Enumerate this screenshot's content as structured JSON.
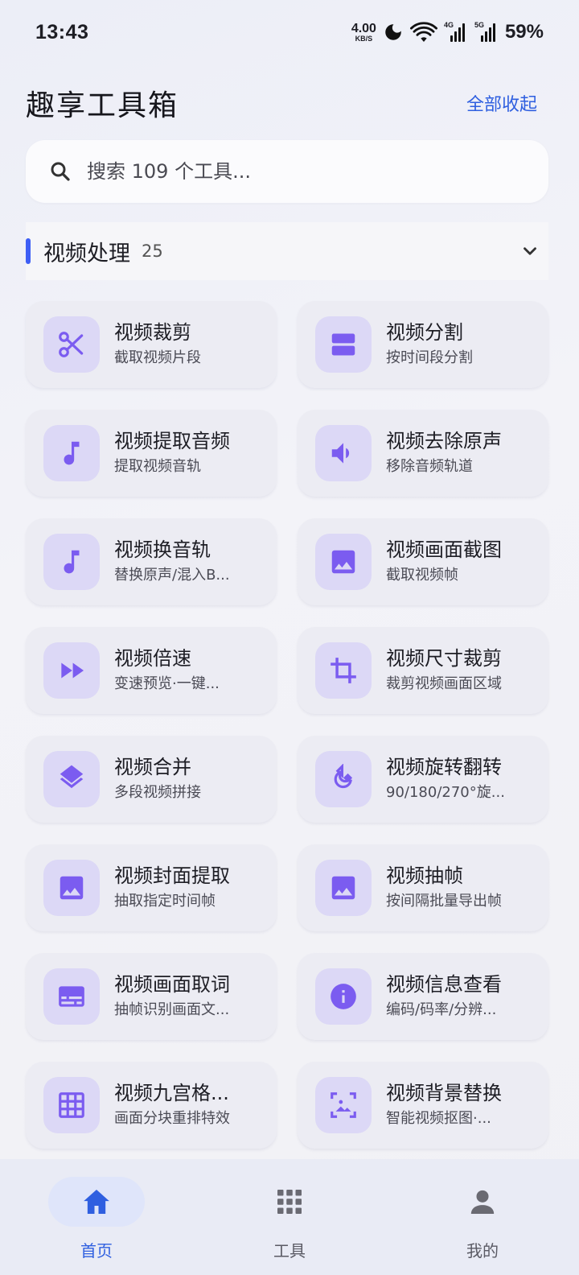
{
  "status_bar": {
    "time": "13:43",
    "net_speed_value": "4.00",
    "net_speed_unit": "KB/S",
    "signal_1_type": "4G",
    "signal_2_type": "5G",
    "battery": "59%"
  },
  "header": {
    "title": "趣享工具箱",
    "collapse_all": "全部收起"
  },
  "search": {
    "placeholder": "搜索 109 个工具..."
  },
  "section": {
    "title": "视频处理",
    "count": "25"
  },
  "colors": {
    "accent": "#2f5fe0",
    "section_bar": "#3d5ef5",
    "icon_color": "#7b5cf0",
    "icon_bg": "#dcd8f6",
    "card_bg": "#ececf3"
  },
  "tools": [
    {
      "title": "视频裁剪",
      "subtitle": "截取视频片段",
      "icon": "scissors-icon"
    },
    {
      "title": "视频分割",
      "subtitle": "按时间段分割",
      "icon": "split-icon"
    },
    {
      "title": "视频提取音频",
      "subtitle": "提取视频音轨",
      "icon": "music-note-icon"
    },
    {
      "title": "视频去除原声",
      "subtitle": "移除音频轨道",
      "icon": "speaker-icon"
    },
    {
      "title": "视频换音轨",
      "subtitle": "替换原声/混入B...",
      "icon": "music-note-icon"
    },
    {
      "title": "视频画面截图",
      "subtitle": "截取视频帧",
      "icon": "image-icon"
    },
    {
      "title": "视频倍速",
      "subtitle": "变速预览·一键...",
      "icon": "fast-forward-icon"
    },
    {
      "title": "视频尺寸裁剪",
      "subtitle": "裁剪视频画面区域",
      "icon": "crop-icon"
    },
    {
      "title": "视频合并",
      "subtitle": "多段视频拼接",
      "icon": "layers-icon"
    },
    {
      "title": "视频旋转翻转",
      "subtitle": "90/180/270°旋...",
      "icon": "rotate-icon"
    },
    {
      "title": "视频封面提取",
      "subtitle": "抽取指定时间帧",
      "icon": "image-icon"
    },
    {
      "title": "视频抽帧",
      "subtitle": "按间隔批量导出帧",
      "icon": "image-icon"
    },
    {
      "title": "视频画面取词",
      "subtitle": "抽帧识别画面文...",
      "icon": "subtitles-icon"
    },
    {
      "title": "视频信息查看",
      "subtitle": "编码/码率/分辨...",
      "icon": "info-icon"
    },
    {
      "title": "视频九宫格...",
      "subtitle": "画面分块重排特效",
      "icon": "grid-icon"
    },
    {
      "title": "视频背景替换",
      "subtitle": "智能视频抠图·...",
      "icon": "background-replace-icon"
    }
  ],
  "bottom_nav": [
    {
      "label": "首页",
      "icon": "home-icon",
      "active": true
    },
    {
      "label": "工具",
      "icon": "apps-grid-icon",
      "active": false
    },
    {
      "label": "我的",
      "icon": "person-icon",
      "active": false
    }
  ]
}
